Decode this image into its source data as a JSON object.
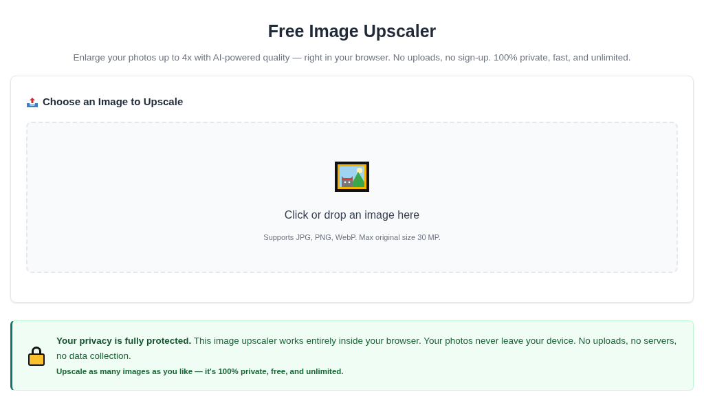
{
  "title": "Free Image Upscaler",
  "subtitle": "Enlarge your photos up to 4x with AI-powered quality — right in your browser. No uploads, no sign-up. 100% private, fast, and unlimited.",
  "upload_card": {
    "heading": "Choose an Image to Upscale",
    "dropzone": {
      "label": "Click or drop an image here",
      "hint": "Supports JPG, PNG, WebP. Max original size 30 MP."
    }
  },
  "privacy_notice": {
    "text": "**Your privacy is fully protected.** This image upscaler works entirely inside your browser. Your photos never leave your device. No uploads, no servers, no data collection.",
    "note": "Upscale as many images as you like — it's 100% private, free, and unlimited."
  }
}
